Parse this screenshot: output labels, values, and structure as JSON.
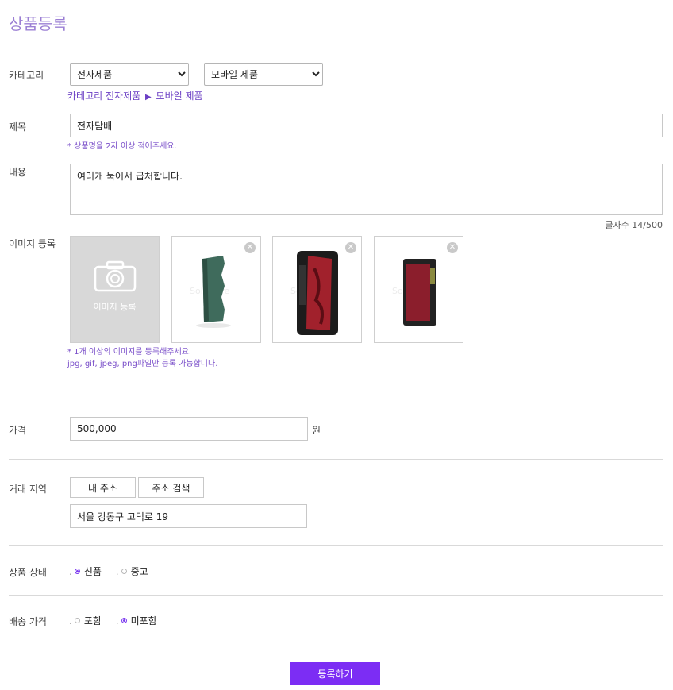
{
  "page": {
    "title": "상품등록"
  },
  "category": {
    "label": "카테고리",
    "primary": "전자제품",
    "secondary": "모바일 제품",
    "path": [
      "카테고리",
      "전자제품",
      "모바일 제품"
    ]
  },
  "subject": {
    "label": "제목",
    "value": "전자담배",
    "hint": "* 상품명을 2자 이상 적어주세요."
  },
  "content": {
    "label": "내용",
    "value": "여러개 묶어서 급처합니다.",
    "count": "글자수 14/500"
  },
  "images": {
    "label": "이미지 등록",
    "upload_text": "이미지 등록",
    "watermark": "Soleware",
    "hint1": "* 1개 이상의 이미지를 등록해주세요.",
    "hint2": "jpg, gif, jpeg, png파일만 등록 가능합니다."
  },
  "price": {
    "label": "가격",
    "value": "500,000",
    "unit": "원"
  },
  "location": {
    "label": "거래 지역",
    "my_address": "내 주소",
    "search_address": "주소 검색",
    "address": "서울 강동구 고덕로 19"
  },
  "condition": {
    "label": "상품 상태",
    "options": [
      {
        "label": "신품",
        "checked": true
      },
      {
        "label": "중고",
        "checked": false
      }
    ]
  },
  "shipping": {
    "label": "배송 가격",
    "options": [
      {
        "label": "포함",
        "checked": false
      },
      {
        "label": "미포함",
        "checked": true
      }
    ]
  },
  "submit_label": "등록하기",
  "colors": {
    "accent": "#7c2df4",
    "title": "#9b7fd4",
    "hint": "#7a4fc9"
  }
}
